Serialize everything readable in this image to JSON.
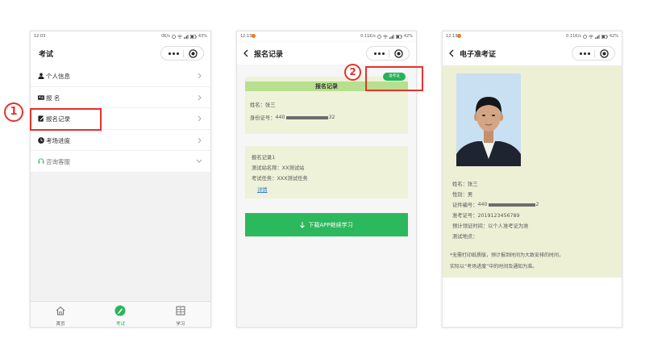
{
  "colors": {
    "accent_green": "#2bb55a",
    "card_bg": "#eef2d8",
    "card_header": "#b8df8e",
    "link_blue": "#3b7bd8",
    "annotation_red": "#e4322b",
    "page_gray": "#f2f2f2"
  },
  "annotations": [
    {
      "number": "1",
      "target": "menu-item-registration-record"
    },
    {
      "number": "2",
      "target": "admission-ticket-badge"
    }
  ],
  "exam_screen": {
    "status": {
      "time": "12:03",
      "speed": "0K/s",
      "battery": "43%"
    },
    "title": "考试",
    "menu": [
      {
        "label": "个人信息",
        "icon": "person-icon",
        "indicator": "chevron-right-icon"
      },
      {
        "label": "报 名",
        "icon": "id-card-icon",
        "indicator": "chevron-right-icon"
      },
      {
        "label": "报名记录",
        "icon": "record-icon",
        "indicator": "chevron-right-icon",
        "highlighted": true
      },
      {
        "label": "考场进度",
        "icon": "progress-icon",
        "indicator": "chevron-right-icon"
      },
      {
        "label": "咨询客服",
        "icon": "headset-icon",
        "indicator": "chevron-down-icon"
      }
    ],
    "tabs": [
      {
        "label": "首页",
        "icon": "home-icon",
        "active": false
      },
      {
        "label": "考试",
        "icon": "exam-icon",
        "active": true
      },
      {
        "label": "学习",
        "icon": "study-icon",
        "active": false
      }
    ]
  },
  "record_screen": {
    "status": {
      "time": "12:13",
      "speed": "0.11K/s",
      "battery": "42%"
    },
    "title": "报名记录",
    "summary_card": {
      "header": "报名记录",
      "badge": "准考证",
      "name": "姓名：张三",
      "id_label": "身份证号：",
      "id_prefix": "440",
      "id_suffix": "32"
    },
    "record_card": {
      "title": "报名记录1",
      "station": "测试站名称：XX测试站",
      "task": "考试任务：XXX测试任务",
      "detail_link": "详情"
    },
    "download_button": "下载APP继续学习"
  },
  "ticket_screen": {
    "status": {
      "time": "12:13",
      "speed": "0.11K/s",
      "battery": "42%"
    },
    "title": "电子准考证",
    "fields": {
      "name": "姓名：张三",
      "gender": "性别：男",
      "id_label": "证件编号：",
      "id_prefix": "440",
      "id_suffix": "2",
      "ticket_no": "准考证号：2019123456789",
      "pickup_time": "预计领证时间：以个人准考证为准",
      "location": "测试地点："
    },
    "notice": [
      "*无需打印纸质版，预计报到时间为大致安排的时间，",
      "实际以“考场进度”中的时间及通知为准。"
    ]
  }
}
